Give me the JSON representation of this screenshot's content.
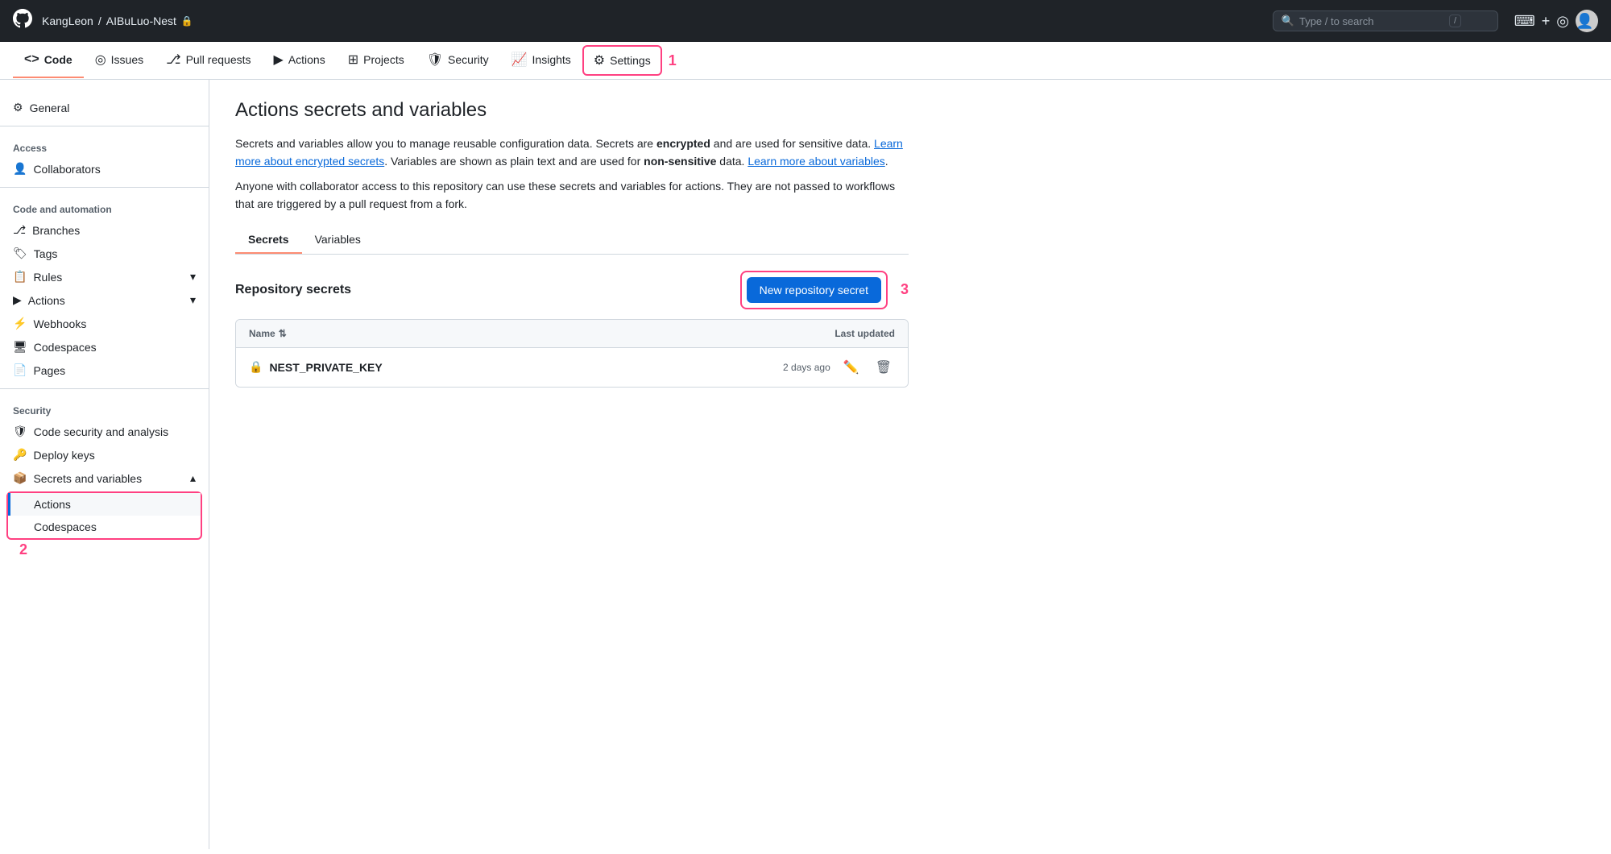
{
  "topbar": {
    "logo": "⬤",
    "user": "KangLeon",
    "separator": "/",
    "repo": "AIBuLuo-Nest",
    "lock_icon": "🔒",
    "search_placeholder": "Type / to search",
    "search_kbd": "/",
    "terminal_icon": "▶",
    "plus_icon": "+",
    "inbox_icon": "◎"
  },
  "repo_nav": {
    "items": [
      {
        "id": "code",
        "icon": "</>",
        "label": "Code",
        "active": false
      },
      {
        "id": "issues",
        "icon": "◎",
        "label": "Issues",
        "active": false
      },
      {
        "id": "pull-requests",
        "icon": "⎇",
        "label": "Pull requests",
        "active": false
      },
      {
        "id": "actions",
        "icon": "▶",
        "label": "Actions",
        "active": false
      },
      {
        "id": "projects",
        "icon": "⊞",
        "label": "Projects",
        "active": false
      },
      {
        "id": "security",
        "icon": "🛡",
        "label": "Security",
        "active": false
      },
      {
        "id": "insights",
        "icon": "📈",
        "label": "Insights",
        "active": false
      },
      {
        "id": "settings",
        "icon": "⚙",
        "label": "Settings",
        "active": true,
        "highlighted": true
      }
    ],
    "annotation_1": "1"
  },
  "sidebar": {
    "general_label": "General",
    "access_section": "Access",
    "collaborators_label": "Collaborators",
    "code_automation_section": "Code and automation",
    "branches_label": "Branches",
    "tags_label": "Tags",
    "rules_label": "Rules",
    "actions_label": "Actions",
    "webhooks_label": "Webhooks",
    "codespaces_label": "Codespaces",
    "pages_label": "Pages",
    "security_section": "Security",
    "code_security_label": "Code security and analysis",
    "deploy_keys_label": "Deploy keys",
    "secrets_variables_label": "Secrets and variables",
    "subitems": {
      "actions_label": "Actions",
      "codespaces_label": "Codespaces"
    }
  },
  "content": {
    "page_title": "Actions secrets and variables",
    "description_1": "Secrets and variables allow you to manage reusable configuration data. Secrets are ",
    "description_bold_1": "encrypted",
    "description_2": " and are used for sensitive data. ",
    "description_link_1": "Learn more about encrypted secrets",
    "description_3": ". Variables are shown as plain text and are used for ",
    "description_bold_2": "non-sensitive",
    "description_4": " data. ",
    "description_link_2": "Learn more about variables",
    "description_5": ".",
    "description_6": "Anyone with collaborator access to this repository can use these secrets and variables for actions. They are not passed to workflows that are triggered by a pull request from a fork.",
    "tabs": [
      {
        "id": "secrets",
        "label": "Secrets",
        "active": true
      },
      {
        "id": "variables",
        "label": "Variables",
        "active": false
      }
    ],
    "repository_secrets_title": "Repository secrets",
    "new_secret_button": "New repository secret",
    "table": {
      "col_name": "Name",
      "col_sort_icon": "⇅",
      "col_last_updated": "Last updated",
      "rows": [
        {
          "icon": "🔒",
          "name": "NEST_PRIVATE_KEY",
          "last_updated": "2 days ago"
        }
      ]
    }
  },
  "annotations": {
    "ann1": "1",
    "ann2": "2",
    "ann3": "3"
  }
}
